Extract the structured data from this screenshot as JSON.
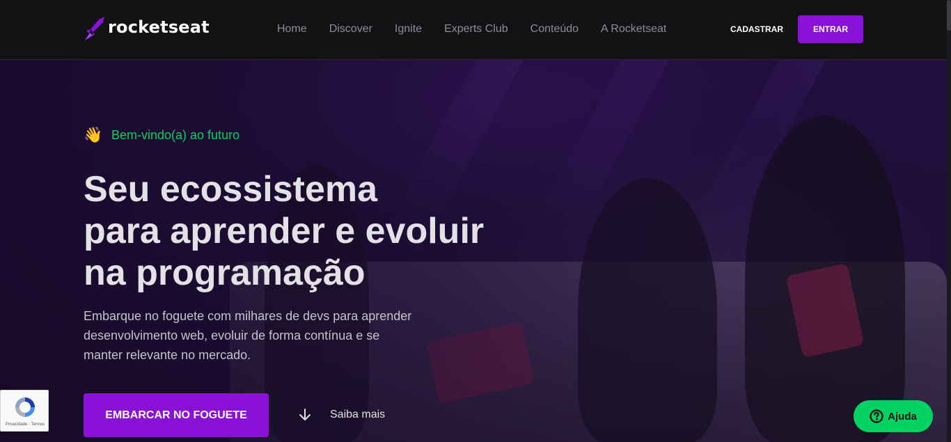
{
  "brand": {
    "name": "rocketseat",
    "accent": "#8a12d6",
    "green": "#04d361"
  },
  "nav": {
    "items": [
      {
        "label": "Home"
      },
      {
        "label": "Discover"
      },
      {
        "label": "Ignite"
      },
      {
        "label": "Experts Club"
      },
      {
        "label": "Conteúdo"
      },
      {
        "label": "A Rocketseat"
      }
    ],
    "signup_label": "CADASTRAR",
    "login_label": "ENTRAR"
  },
  "hero": {
    "welcome_icon": "waving-hand-icon",
    "welcome_text": "Bem-vindo(a) ao futuro",
    "title_lines": [
      "Seu ecossistema",
      "para aprender e evoluir",
      "na programação"
    ],
    "description": "Embarque no foguete com milhares de devs para aprender desenvolvimento web, evoluir de forma contínua e se manter relevante no mercado.",
    "cta_label": "EMBARCAR NO FOGUETE",
    "learn_more_label": "Saiba mais",
    "learn_more_icon": "arrow-down-icon"
  },
  "recaptcha": {
    "text": "Privacidade - Termos"
  },
  "help": {
    "label": "Ajuda",
    "icon": "question-icon"
  }
}
